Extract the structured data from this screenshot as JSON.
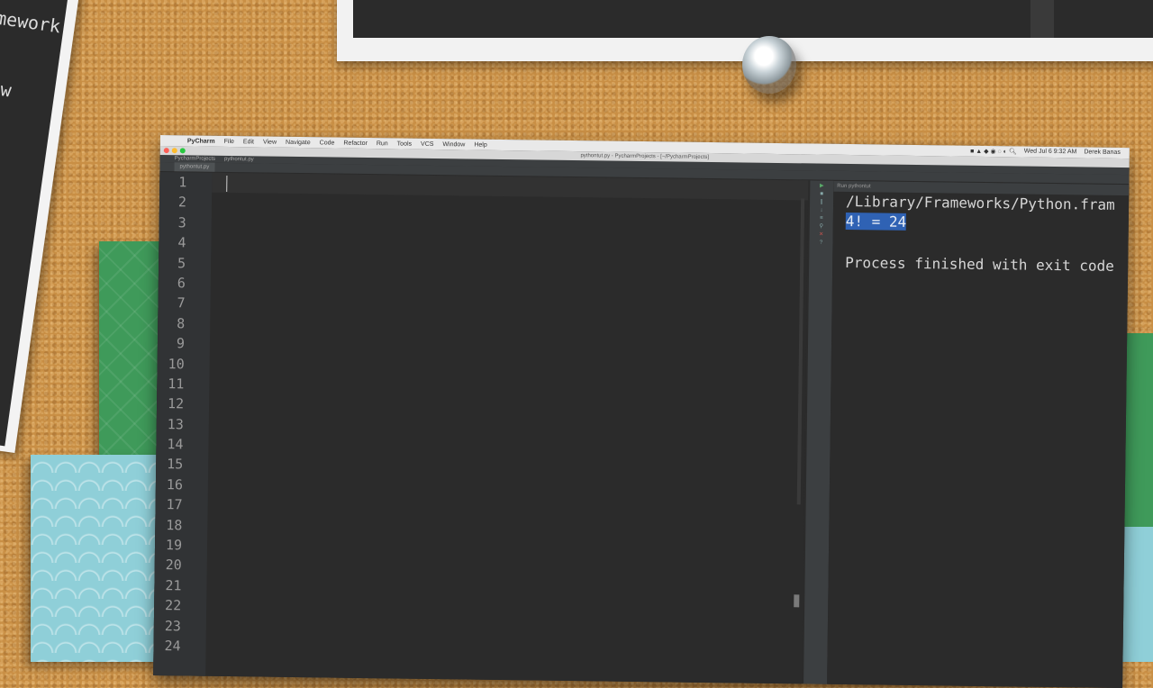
{
  "background": {
    "left_paper_lines": [
      "mework",
      "hed w"
    ]
  },
  "menubar": {
    "app_name": "PyCharm",
    "items": [
      "File",
      "Edit",
      "View",
      "Navigate",
      "Code",
      "Refactor",
      "Run",
      "Tools",
      "VCS",
      "Window",
      "Help"
    ],
    "clock": "Wed Jul 6  9:32 AM",
    "user": "Derek Banas"
  },
  "window": {
    "title": "pythontut.py - PycharmProjects - [~/PycharmProjects]",
    "breadcrumb": [
      "PycharmProjects",
      "pythontut.py"
    ],
    "active_tab": "pythontut.py"
  },
  "editor": {
    "line_numbers": [
      "1",
      "2",
      "3",
      "4",
      "5",
      "6",
      "7",
      "8",
      "9",
      "10",
      "11",
      "12",
      "13",
      "14",
      "15",
      "16",
      "17",
      "18",
      "19",
      "20",
      "21",
      "22",
      "23",
      "24"
    ]
  },
  "run_panel": {
    "header": "Run  pythontut",
    "output_path": "/Library/Frameworks/Python.fram",
    "result": "4! =  24",
    "exit_message": "Process finished with exit code"
  },
  "colors": {
    "editor_bg": "#2b2b2b",
    "selection": "#2f62b4",
    "cork": "#c98f45"
  }
}
